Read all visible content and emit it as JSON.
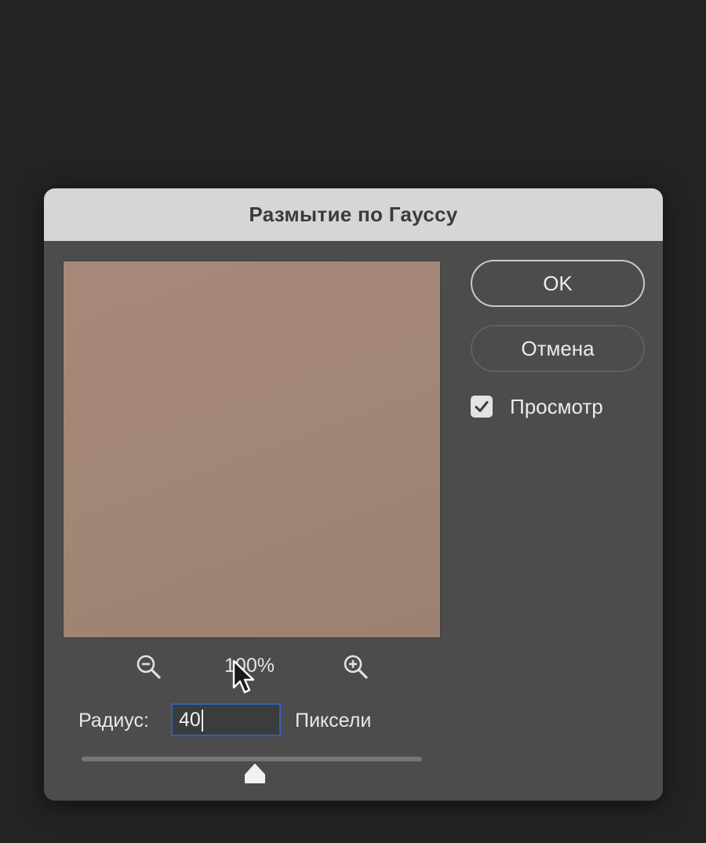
{
  "dialog": {
    "title": "Размытие по Гауссу",
    "ok_label": "OK",
    "cancel_label": "Отмена",
    "preview_checkbox": {
      "label": "Просмотр",
      "checked": true
    },
    "preview_color": "#a38777",
    "zoom": {
      "label": "100%",
      "zoom_out_icon": "zoom-out-icon",
      "zoom_in_icon": "zoom-in-icon"
    },
    "radius": {
      "label": "Радиус:",
      "value": "40",
      "units": "Пиксели"
    },
    "slider": {
      "position_fraction": 0.51
    }
  },
  "colors": {
    "background": "#222322",
    "dialog": "#4b4c4b",
    "titlebar": "#d6d6d5",
    "focus_ring": "#2f62b9"
  }
}
